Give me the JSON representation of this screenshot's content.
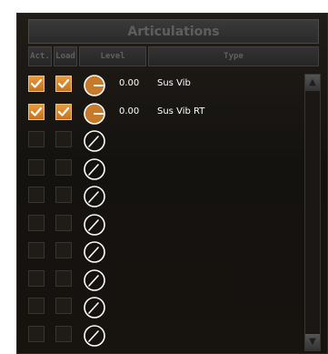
{
  "panel": {
    "title": "Articulations"
  },
  "columns": {
    "act": "Act.",
    "load": "Load",
    "level": "Level",
    "type": "Type"
  },
  "colors": {
    "accent": "#e08a2c",
    "knob_fill": "#c77a2a",
    "text": "#ffffff"
  },
  "rows": [
    {
      "act": true,
      "load": true,
      "level": "0.00",
      "type": "Sus Vib",
      "knob_filled": true
    },
    {
      "act": true,
      "load": true,
      "level": "0.00",
      "type": "Sus Vib RT",
      "knob_filled": true
    },
    {
      "act": false,
      "load": false,
      "level": "",
      "type": "",
      "knob_filled": false
    },
    {
      "act": false,
      "load": false,
      "level": "",
      "type": "",
      "knob_filled": false
    },
    {
      "act": false,
      "load": false,
      "level": "",
      "type": "",
      "knob_filled": false
    },
    {
      "act": false,
      "load": false,
      "level": "",
      "type": "",
      "knob_filled": false
    },
    {
      "act": false,
      "load": false,
      "level": "",
      "type": "",
      "knob_filled": false
    },
    {
      "act": false,
      "load": false,
      "level": "",
      "type": "",
      "knob_filled": false
    },
    {
      "act": false,
      "load": false,
      "level": "",
      "type": "",
      "knob_filled": false
    },
    {
      "act": false,
      "load": false,
      "level": "",
      "type": "",
      "knob_filled": false
    }
  ],
  "scrollbar": {
    "up_icon": "triangle-up-icon",
    "down_icon": "triangle-down-icon"
  }
}
